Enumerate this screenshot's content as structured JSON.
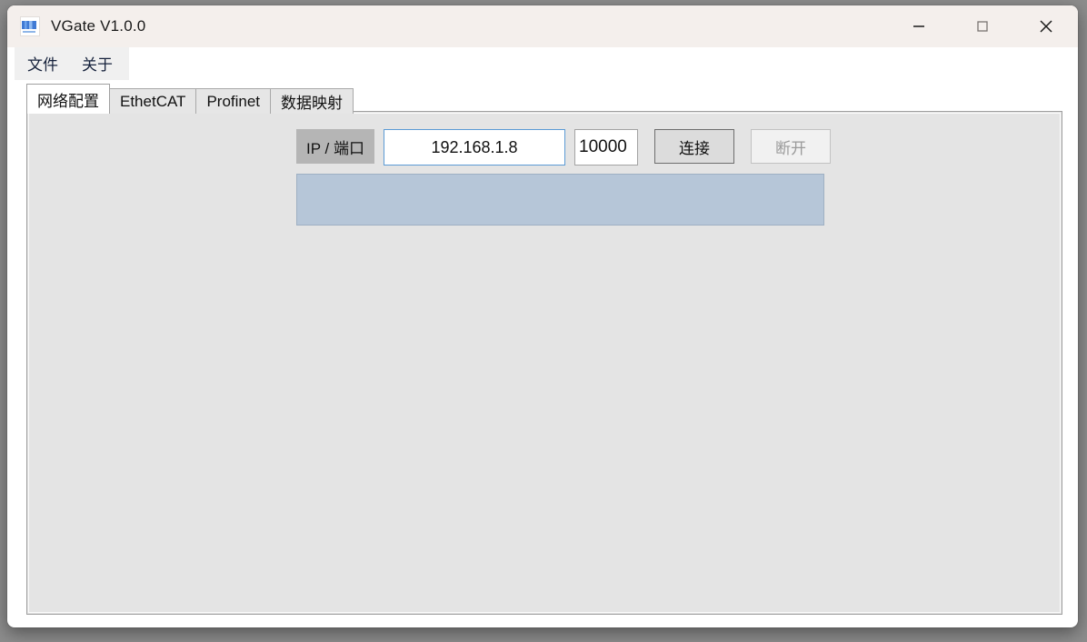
{
  "window": {
    "title": "VGate V1.0.0",
    "icon": "app-logo-icon",
    "controls": {
      "minimize": "minimize-icon",
      "maximize": "maximize-icon",
      "close": "close-icon"
    }
  },
  "menubar": {
    "items": [
      {
        "label": "文件"
      },
      {
        "label": "关于"
      }
    ]
  },
  "tabs": [
    {
      "label": "网络配置",
      "active": true
    },
    {
      "label": "EthetCAT",
      "active": false
    },
    {
      "label": "Profinet",
      "active": false
    },
    {
      "label": "数据映射",
      "active": false
    }
  ],
  "network_page": {
    "ip_port_label": "IP / 端口",
    "ip_value": "192.168.1.8",
    "ip_placeholder": "",
    "port_value": "10000",
    "port_placeholder": "",
    "connect_label": "连接",
    "disconnect_label": "断开",
    "disconnect_disabled": true,
    "log_items": []
  },
  "colors": {
    "titlebar": "#f4efec",
    "accent_focus": "#5b9bd5",
    "panel": "#e4e4e4",
    "log_background": "#b6c6d8",
    "label_background": "#b5b5b5",
    "button_face": "#dcdcdc",
    "disabled_text": "#9a9a9a"
  }
}
